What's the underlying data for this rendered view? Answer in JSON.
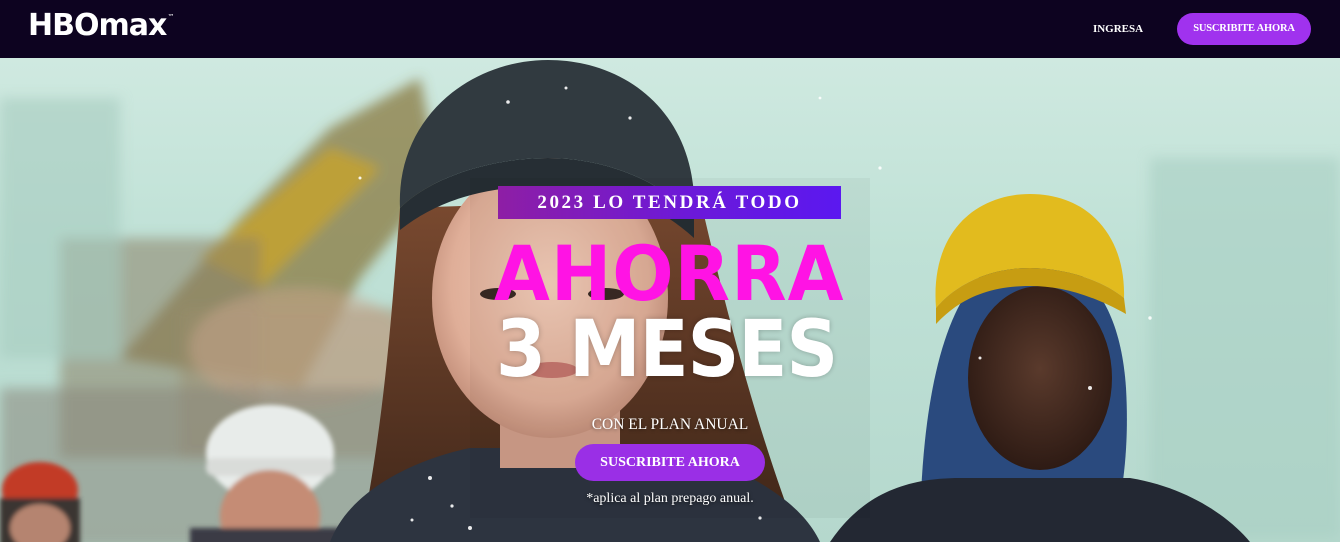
{
  "header": {
    "logo_text": "HBOmax",
    "logo_tm": "™",
    "login_label": "INGRESA",
    "subscribe_label": "SUSCRIBITE AHORA"
  },
  "hero": {
    "tag": "2023 LO TENDRÁ TODO",
    "headline_line1": "AHORRA",
    "headline_line2": "3 MESES",
    "plan_text": "CON EL PLAN ANUAL",
    "cta_label": "SUSCRIBITE AHORA",
    "disclaimer": "*aplica al plan prepago anual."
  },
  "colors": {
    "nav_background": "#0d0320",
    "accent_purple": "#a032ee",
    "headline_magenta": "#ff13e4",
    "tag_gradient_start": "#8e1ea5",
    "tag_gradient_end": "#5b18f0"
  }
}
